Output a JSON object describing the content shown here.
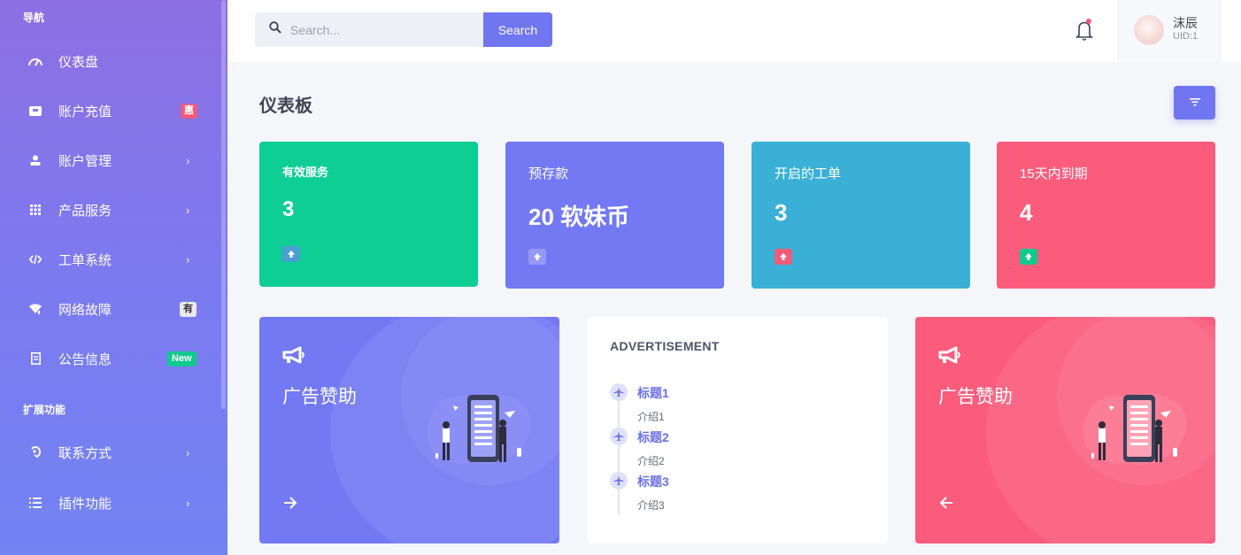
{
  "sidebar": {
    "section_nav": "导航",
    "section_ext": "扩展功能",
    "items": [
      {
        "label": "仪表盘",
        "icon": "gauge-icon"
      },
      {
        "label": "账户充值",
        "icon": "wallet-icon",
        "badge": "惠"
      },
      {
        "label": "账户管理",
        "icon": "user-icon"
      },
      {
        "label": "产品服务",
        "icon": "grid-icon"
      },
      {
        "label": "工单系统",
        "icon": "code-icon"
      },
      {
        "label": "网络故障",
        "icon": "wifi-icon",
        "badge": "有"
      },
      {
        "label": "公告信息",
        "icon": "document-icon",
        "badge": "New"
      },
      {
        "label": "联系方式",
        "icon": "contact-icon"
      },
      {
        "label": "插件功能",
        "icon": "list-icon"
      }
    ]
  },
  "topbar": {
    "search_placeholder": "Search...",
    "search_button": "Search",
    "user_name": "沫辰",
    "user_uid": "UID:1"
  },
  "page": {
    "title": "仪表板"
  },
  "stats": [
    {
      "label": "有效服务",
      "value": "3",
      "color": "#0fce94"
    },
    {
      "label": "预存款",
      "value": "20 软妹币",
      "color": "#7279f2"
    },
    {
      "label": "开启的工单",
      "value": "3",
      "color": "#3bb0d6"
    },
    {
      "label": "15天内到期",
      "value": "4",
      "color": "#fb5c7c"
    }
  ],
  "ads": {
    "left_title": "广告赞助",
    "right_title": "广告赞助",
    "center": {
      "heading": "ADVERTISEMENT",
      "items": [
        {
          "title": "标题1",
          "desc": "介绍1"
        },
        {
          "title": "标题2",
          "desc": "介绍2"
        },
        {
          "title": "标题3",
          "desc": "介绍3"
        }
      ]
    }
  },
  "colors": {
    "accent": "#7075f0",
    "green": "#0fce94",
    "cyan": "#3bb0d6",
    "pink": "#fb5c7c"
  }
}
